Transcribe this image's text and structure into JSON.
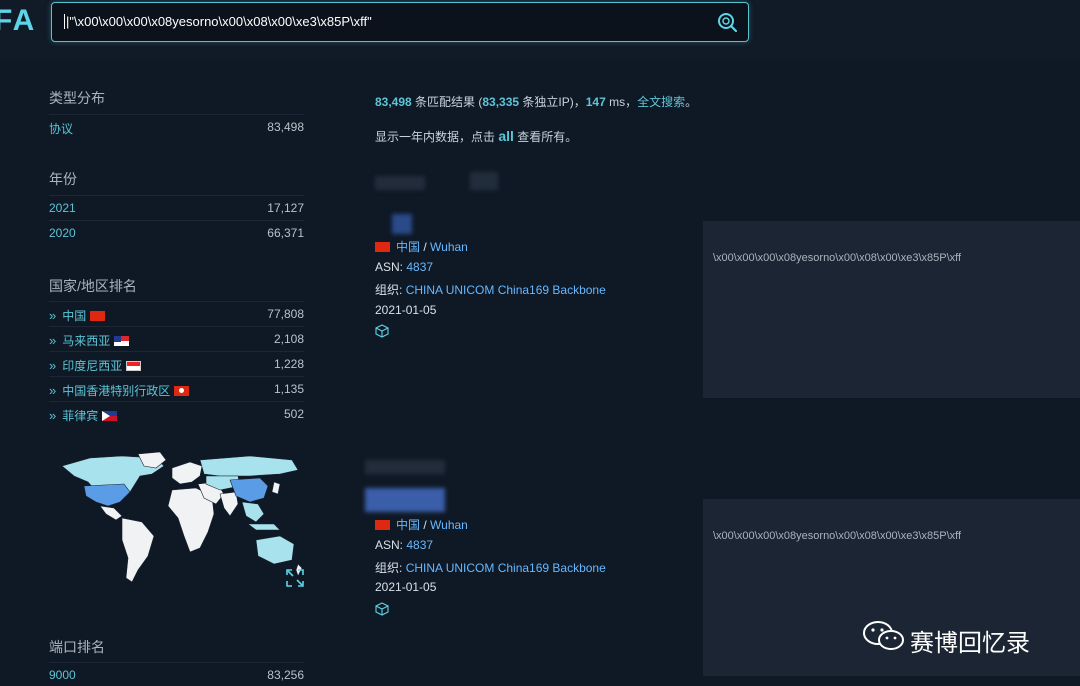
{
  "logo": "FA",
  "search": {
    "query": "|\"\\x00\\x00\\x00\\x08yesorno\\x00\\x08\\x00\\xe3\\x85P\\xff\""
  },
  "sidebar": {
    "type_title": "类型分布",
    "types": [
      {
        "label": "协议",
        "count": "83,498"
      }
    ],
    "year_title": "年份",
    "years": [
      {
        "label": "2021",
        "count": "17,127"
      },
      {
        "label": "2020",
        "count": "66,371"
      }
    ],
    "country_title": "国家/地区排名",
    "countries": [
      {
        "label": "中国",
        "count": "77,808",
        "flag": "cn"
      },
      {
        "label": "马来西亚",
        "count": "2,108",
        "flag": "my"
      },
      {
        "label": "印度尼西亚",
        "count": "1,228",
        "flag": "id"
      },
      {
        "label": "中国香港特别行政区",
        "count": "1,135",
        "flag": "hk"
      },
      {
        "label": "菲律宾",
        "count": "502",
        "flag": "ph"
      }
    ],
    "port_title": "端口排名",
    "ports": [
      {
        "label": "9000",
        "count": "83,256"
      }
    ]
  },
  "summary": {
    "count": "83,498",
    "text1": " 条匹配结果 (",
    "unique": "83,335",
    "text2": " 条独立IP)，",
    "ms": "147",
    "text3": " ms，",
    "fulltext": "全文搜索",
    "text4": "。"
  },
  "note": {
    "prefix": "显示一年内数据，点击 ",
    "all": "all",
    "suffix": " 查看所有。"
  },
  "results": [
    {
      "country": "中国",
      "city": "Wuhan",
      "asn_label": "ASN:",
      "asn": "4837",
      "org_label": "组织:",
      "org": "CHINA UNICOM China169 Backbone",
      "date": "2021-01-05",
      "banner": "\\x00\\x00\\x00\\x08yesorno\\x00\\x08\\x00\\xe3\\x85P\\xff"
    },
    {
      "country": "中国",
      "city": "Wuhan",
      "asn_label": "ASN:",
      "asn": "4837",
      "org_label": "组织:",
      "org": "CHINA UNICOM China169 Backbone",
      "date": "2021-01-05",
      "banner": "\\x00\\x00\\x00\\x08yesorno\\x00\\x08\\x00\\xe3\\x85P\\xff"
    }
  ],
  "watermark": "赛博回忆录",
  "colors": {
    "accent": "#5cc5d6",
    "link": "#66b8ff",
    "background": "#0f1825"
  }
}
